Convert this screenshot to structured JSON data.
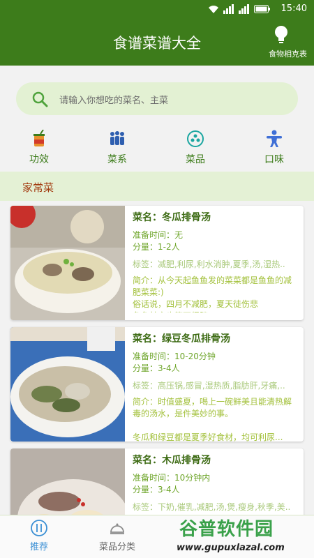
{
  "status_bar": {
    "time": "15:40"
  },
  "app_bar": {
    "title": "食谱菜谱大全",
    "action_label": "食物相克表"
  },
  "search": {
    "placeholder": "请输入你想吃的菜名、主菜"
  },
  "categories": [
    {
      "label": "功效",
      "icon": "cup-icon"
    },
    {
      "label": "菜系",
      "icon": "people-icon"
    },
    {
      "label": "菜品",
      "icon": "molecule-icon"
    },
    {
      "label": "口味",
      "icon": "person-icon"
    }
  ],
  "section": {
    "title": "家常菜"
  },
  "recipes": [
    {
      "name": "菜名：冬瓜排骨汤",
      "prep": "准备时间：无",
      "serving": "分量：1-2人",
      "tags": "标签：减肥,利尿,利水消肿,夏季,汤,湿热..",
      "intro": "简介：从今天起鱼鱼发的菜菜都是鱼鱼的减肥菜菜:)\n俗话说，四月不减肥，夏天徒伤悲\n鱼鱼其实也算不得胖..."
    },
    {
      "name": "菜名：绿豆冬瓜排骨汤",
      "prep": "准备时间：10-20分钟",
      "serving": "分量：3-4人",
      "tags": "标签：高压锅,感冒,湿热质,脂肪肝,牙痛,..",
      "intro": "简介：时值盛夏，喝上一碗鲜美且能清热解毒的汤水，是件美妙的事。\n\n冬瓜和绿豆都是夏季好食材，均可利尿..."
    },
    {
      "name": "菜名：木瓜排骨汤",
      "prep": "准备时间：10分钟内",
      "serving": "分量：3-4人",
      "tags": "标签：下奶,催乳,减肥,汤,煲,瘦身,秋季,美..",
      "intro": ""
    }
  ],
  "bottom_nav": [
    {
      "label": "推荐",
      "active": true
    },
    {
      "label": "菜品分类",
      "active": false
    }
  ],
  "watermark": {
    "title": "谷普软件园",
    "url": "www.gupuxlazal.com"
  },
  "colors": {
    "primary": "#3d7c1b",
    "accent": "#3a8fd4",
    "search_bg": "#e3f1d3"
  }
}
